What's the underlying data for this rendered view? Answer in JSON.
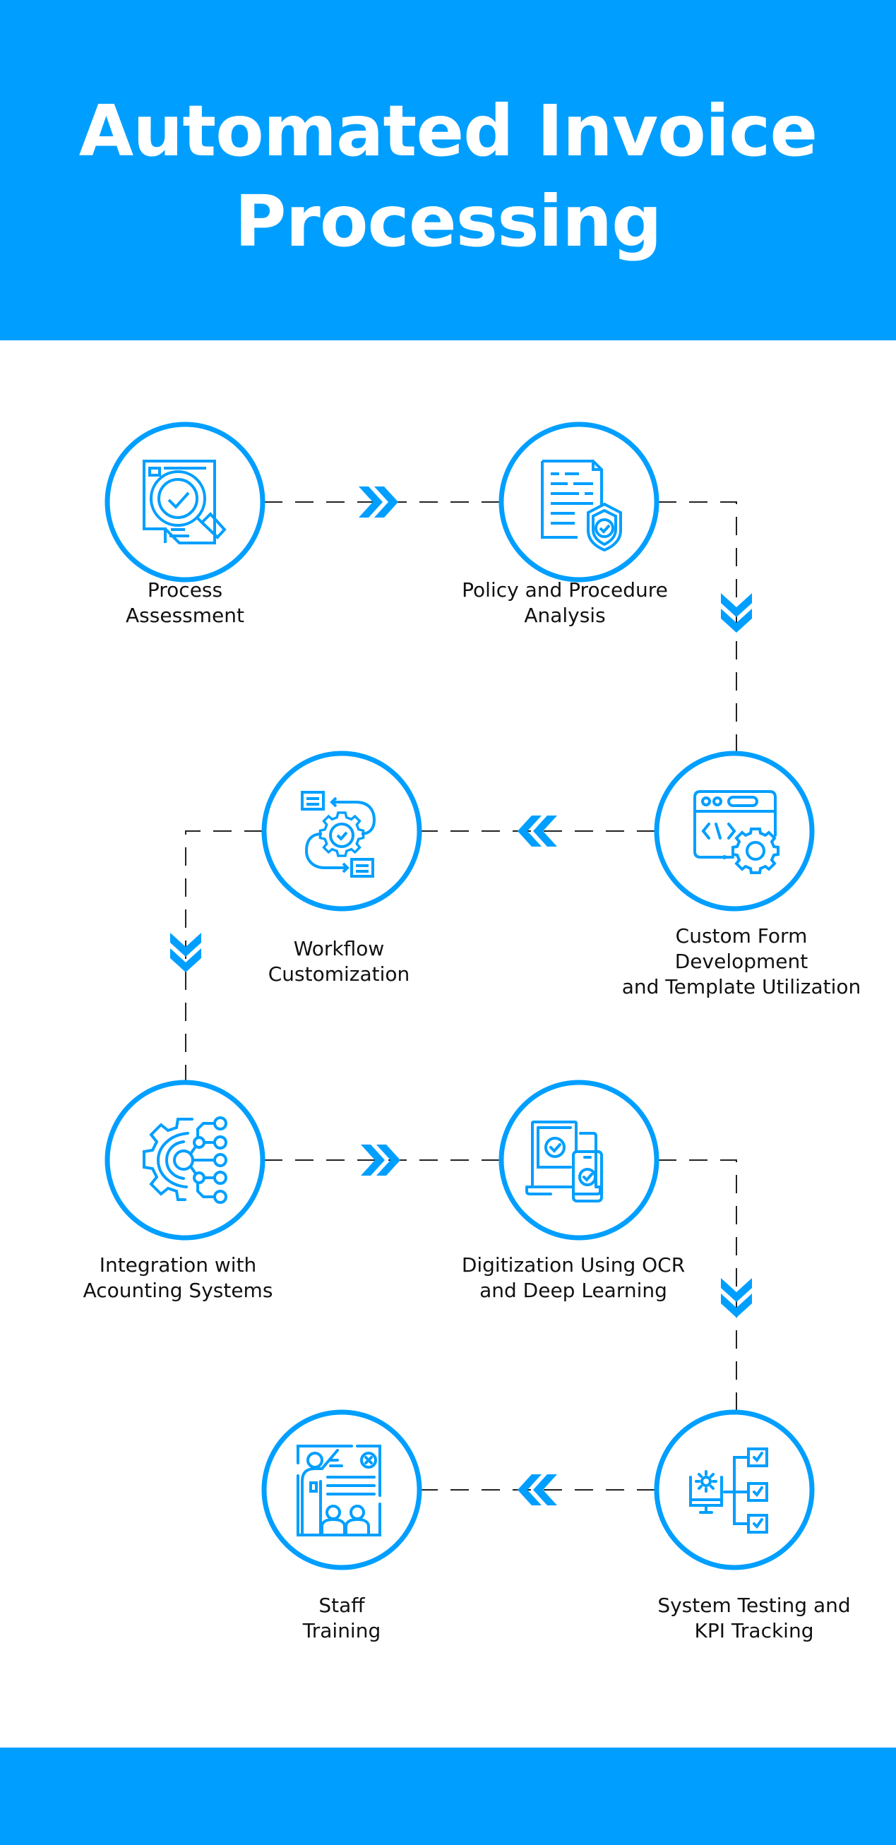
{
  "header": {
    "title_line1": "Automated Invoice",
    "title_line2": "Processing"
  },
  "colors": {
    "brand": "#009FFF",
    "connector": "#222222",
    "text": "#111111",
    "background": "#FFFFFF"
  },
  "steps": [
    {
      "label": "Process\nAssessment",
      "icon": "document-magnifier-check-icon"
    },
    {
      "label": "Policy and Procedure\nAnalysis",
      "icon": "document-shield-check-icon"
    },
    {
      "label": "Custom Form\nDevelopment\nand Template Utilization",
      "icon": "code-window-gear-icon"
    },
    {
      "label": "Workflow\nCustomization",
      "icon": "gear-cycle-forms-icon"
    },
    {
      "label": "Integration with\nAcounting Systems",
      "icon": "gear-circuit-icon"
    },
    {
      "label": "Digitization Using OCR\nand Deep Learning",
      "icon": "laptop-phone-check-icon"
    },
    {
      "label": "System Testing and\nKPI Tracking",
      "icon": "monitor-gear-checklist-icon"
    },
    {
      "label": "Staff\nTraining",
      "icon": "presenter-classroom-icon"
    }
  ],
  "connectors": [
    {
      "from": 1,
      "to": 2,
      "direction": "right"
    },
    {
      "from": 2,
      "to": 3,
      "direction": "down"
    },
    {
      "from": 3,
      "to": 4,
      "direction": "left"
    },
    {
      "from": 4,
      "to": 5,
      "direction": "down"
    },
    {
      "from": 5,
      "to": 6,
      "direction": "right"
    },
    {
      "from": 6,
      "to": 7,
      "direction": "down"
    },
    {
      "from": 7,
      "to": 8,
      "direction": "left"
    }
  ]
}
